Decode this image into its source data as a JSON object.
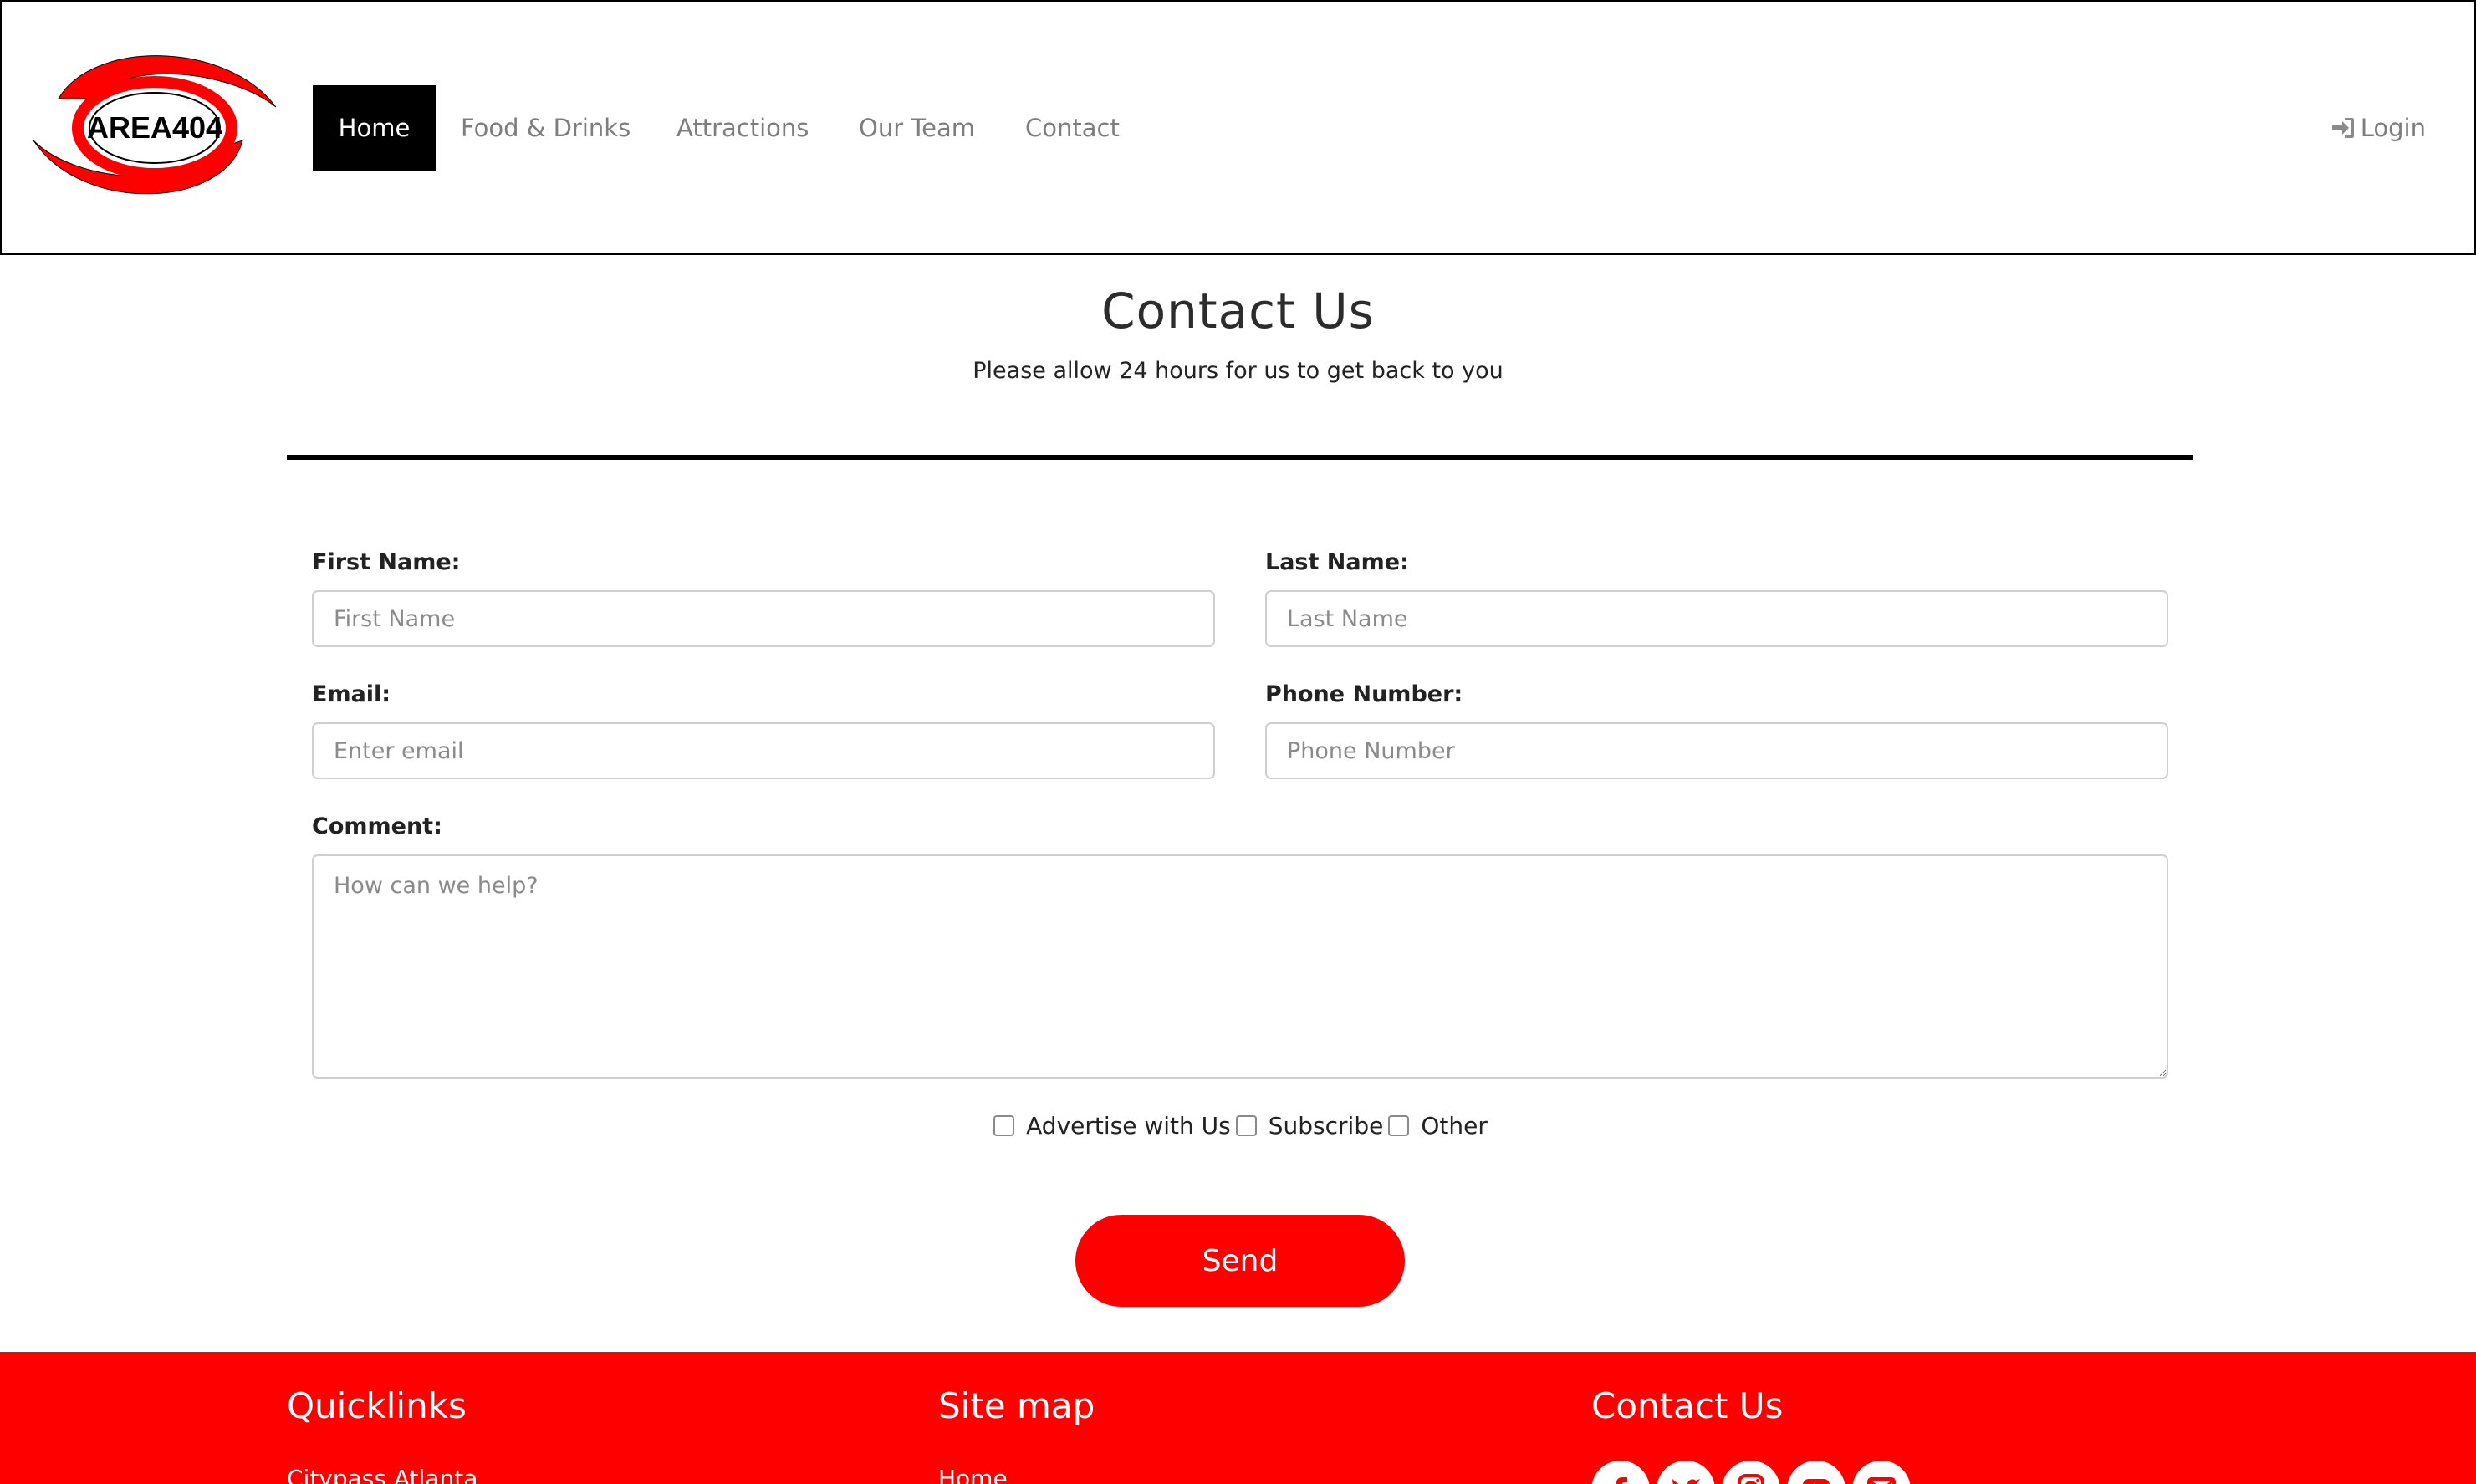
{
  "brand": {
    "logo_text": "AREA404"
  },
  "nav": {
    "items": [
      "Home",
      "Food & Drinks",
      "Attractions",
      "Our Team",
      "Contact"
    ],
    "login": "Login"
  },
  "header": {
    "title": "Contact Us",
    "subtitle": "Please allow 24 hours for us to get back to you"
  },
  "form": {
    "first_name": {
      "label": "First Name:",
      "placeholder": "First Name"
    },
    "last_name": {
      "label": "Last Name:",
      "placeholder": "Last Name"
    },
    "email": {
      "label": "Email:",
      "placeholder": "Enter email"
    },
    "phone": {
      "label": "Phone Number:",
      "placeholder": "Phone Number"
    },
    "comment": {
      "label": "Comment:",
      "placeholder": "How can we help?"
    },
    "checkboxes": [
      "Advertise with Us",
      "Subscribe",
      "Other"
    ],
    "send": "Send"
  },
  "footer": {
    "quicklinks": {
      "heading": "Quicklinks",
      "first_link": "Citypass Atlanta"
    },
    "sitemap": {
      "heading": "Site map",
      "first_link": "Home"
    },
    "contact": {
      "heading": "Contact Us",
      "icons": [
        "facebook-icon",
        "twitter-icon",
        "instagram-icon",
        "youtube-icon",
        "email-icon"
      ]
    }
  },
  "colors": {
    "accent": "#ff0000",
    "nav_active_bg": "#000000",
    "nav_text": "#7d7d7d"
  }
}
